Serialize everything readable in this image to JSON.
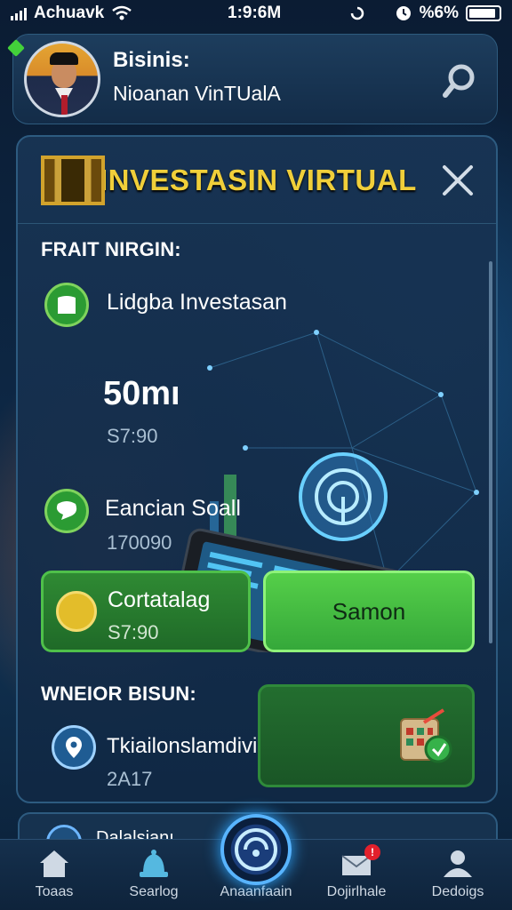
{
  "status_bar": {
    "carrier": "Achuavk",
    "time": "1:9:6M",
    "battery_text": "%6%"
  },
  "header": {
    "title": "Bisinis:",
    "subtitle": "Nioanan VinTUalA"
  },
  "panel": {
    "title": "INVESTASIN VIRTUAL",
    "section_label": "FRAIT NIRGIN:",
    "item1": {
      "label": "Lidgba Investasan"
    },
    "big_value": "50mı",
    "big_sub": "S7:90",
    "item2": {
      "label": "Eancian Soall",
      "value": "170090"
    },
    "card_left": {
      "label": "Cortatalag",
      "value": "S7:90"
    },
    "card_right": {
      "label": "Samon"
    },
    "section2_label": "WNEIOR BISUN:",
    "item3": {
      "label": "Tkiailonslamdivirtarıl",
      "value": "2A17"
    }
  },
  "peek": {
    "label": "Dalalsianı"
  },
  "nav": {
    "items": [
      {
        "label": "Toaas"
      },
      {
        "label": "Searlog"
      },
      {
        "label": "Anaanfaain"
      },
      {
        "label": "Dojirlhale"
      },
      {
        "label": "Dedoigs"
      }
    ],
    "badge": "!"
  },
  "colors": {
    "accent_gold": "#f0cf3a",
    "green": "#35a83a",
    "bg": "#0d2744"
  }
}
